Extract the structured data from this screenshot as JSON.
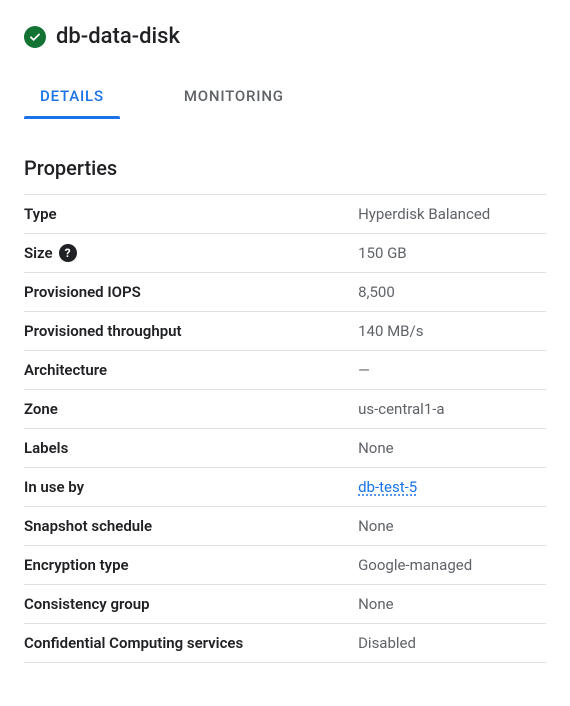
{
  "header": {
    "title": "db-data-disk"
  },
  "tabs": [
    {
      "label": "DETAILS",
      "active": true
    },
    {
      "label": "MONITORING",
      "active": false
    }
  ],
  "section_title": "Properties",
  "properties": [
    {
      "key": "Type",
      "value": "Hyperdisk Balanced"
    },
    {
      "key": "Size",
      "value": "150 GB",
      "help": true
    },
    {
      "key": "Provisioned IOPS",
      "value": "8,500"
    },
    {
      "key": "Provisioned throughput",
      "value": "140 MB/s"
    },
    {
      "key": "Architecture",
      "value": "—"
    },
    {
      "key": "Zone",
      "value": "us-central1-a"
    },
    {
      "key": "Labels",
      "value": "None"
    },
    {
      "key": "In use by",
      "value": "db-test-5",
      "link": true
    },
    {
      "key": "Snapshot schedule",
      "value": "None"
    },
    {
      "key": "Encryption type",
      "value": "Google-managed"
    },
    {
      "key": "Consistency group",
      "value": "None"
    },
    {
      "key": "Confidential Computing services",
      "value": "Disabled"
    }
  ],
  "help_glyph": "?"
}
